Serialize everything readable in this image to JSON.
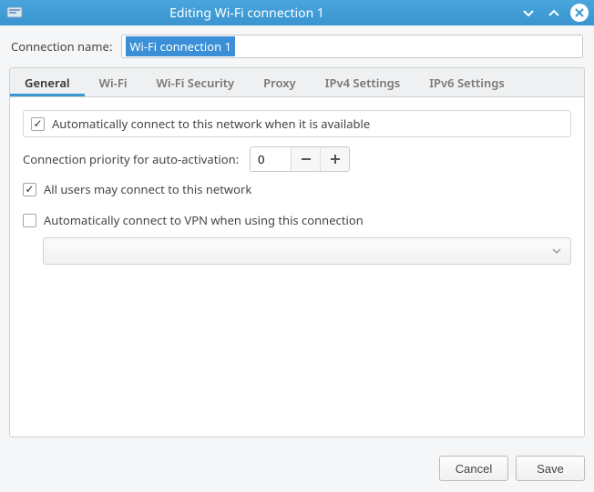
{
  "window": {
    "title": "Editing Wi-Fi connection 1"
  },
  "form": {
    "connection_name_label": "Connection name:",
    "connection_name_value": "Wi-Fi connection 1"
  },
  "tabs": {
    "general": "General",
    "wifi": "Wi-Fi",
    "wifi_security": "Wi-Fi Security",
    "proxy": "Proxy",
    "ipv4": "IPv4 Settings",
    "ipv6": "IPv6 Settings"
  },
  "general": {
    "auto_connect_label": "Automatically connect to this network when it is available",
    "auto_connect_checked": true,
    "priority_label": "Connection priority for auto-activation:",
    "priority_value": "0",
    "all_users_label": "All users may connect to this network",
    "all_users_checked": true,
    "vpn_label": "Automatically connect to VPN when using this connection",
    "vpn_checked": false,
    "vpn_selected": ""
  },
  "footer": {
    "cancel": "Cancel",
    "save": "Save"
  }
}
